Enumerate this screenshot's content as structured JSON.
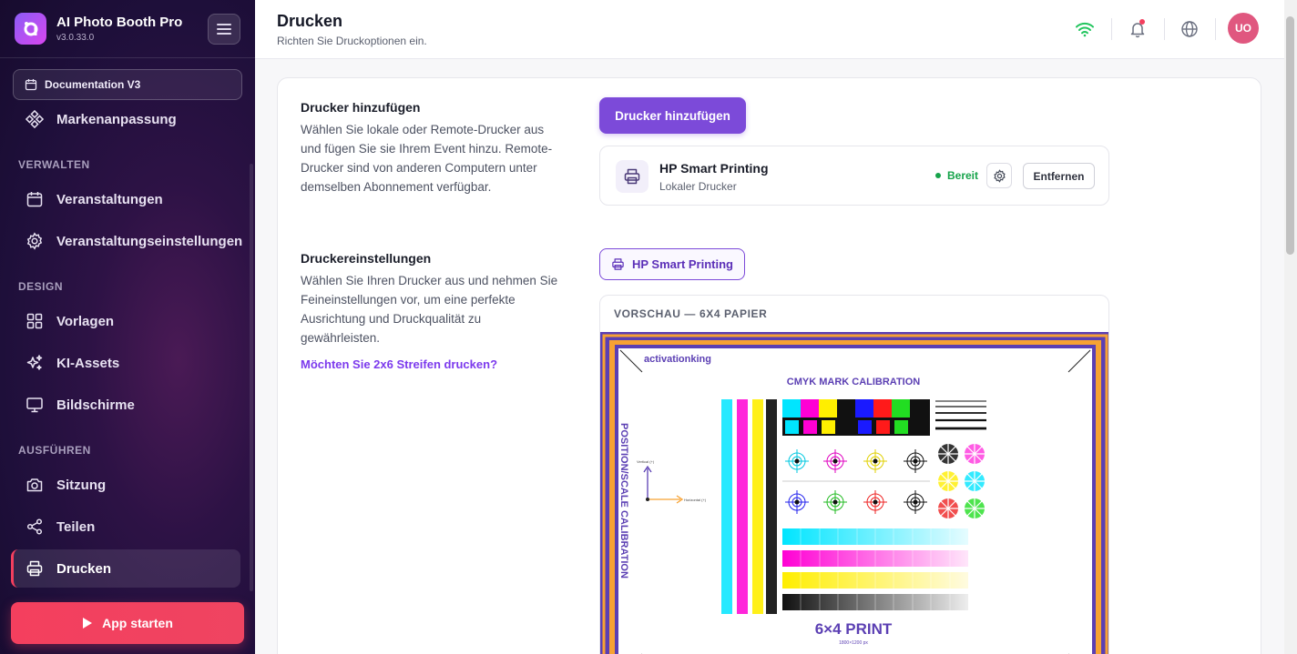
{
  "app": {
    "name": "AI Photo Booth Pro",
    "version": "v3.0.33.0"
  },
  "sidebar": {
    "documentation_label": "Documentation V3",
    "top_item": "Markenanpassung",
    "sections": [
      {
        "label": "VERWALTEN",
        "items": [
          "Veranstaltungen",
          "Veranstaltungseinstellungen"
        ]
      },
      {
        "label": "DESIGN",
        "items": [
          "Vorlagen",
          "KI-Assets",
          "Bildschirme"
        ]
      },
      {
        "label": "AUSFÜHREN",
        "items": [
          "Sitzung",
          "Teilen",
          "Drucken"
        ]
      }
    ],
    "active_item": "Drucken",
    "start_button": "App starten"
  },
  "header": {
    "title": "Drucken",
    "subtitle": "Richten Sie Druckoptionen ein.",
    "avatar_initials": "UO"
  },
  "add_printer": {
    "title": "Drucker hinzufügen",
    "description": "Wählen Sie lokale oder Remote-Drucker aus und fügen Sie sie Ihrem Event hinzu. Remote-Drucker sind von anderen Computern unter demselben Abonnement verfügbar.",
    "button": "Drucker hinzufügen",
    "printer": {
      "name": "HP Smart Printing",
      "type": "Lokaler Drucker",
      "status": "Bereit",
      "remove_button": "Entfernen"
    }
  },
  "printer_settings": {
    "title": "Druckereinstellungen",
    "description": "Wählen Sie Ihren Drucker aus und nehmen Sie Feineinstellungen vor, um eine perfekte Ausrichtung und Druckqualität zu gewährleisten.",
    "strip_link": "Möchten Sie 2x6 Streifen drucken?",
    "selected_printer": "HP Smart Printing",
    "preview_label": "VORSCHAU — 6X4 PAPIER",
    "calibration": {
      "brand": "activationking",
      "title": "CMYK MARK CALIBRATION",
      "side_title": "POSITION/SCALE CALIBRATION",
      "vertical_label": "Vertical (+)",
      "horizontal_label": "Horizontal (+)",
      "print_label": "6×4 PRINT",
      "print_size": "1800×1200 px"
    }
  },
  "colors": {
    "accent": "#7c4ad9",
    "danger": "#f43f5e",
    "ready": "#16a34a"
  }
}
